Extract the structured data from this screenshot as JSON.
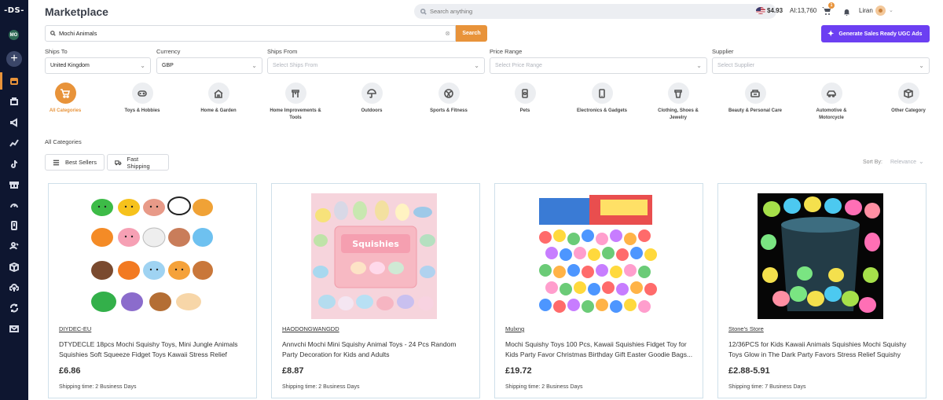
{
  "sidebar": {
    "logo": "-DS-",
    "avatar_initials": "MO",
    "items": [
      "add",
      "marketplace",
      "store",
      "campaigns",
      "analytics",
      "tiktok",
      "gift",
      "speed",
      "orders",
      "users",
      "packages",
      "upload",
      "sync",
      "mail"
    ]
  },
  "header": {
    "title": "Marketplace",
    "search_placeholder": "Search anything",
    "balance": "$4.93",
    "ai_credits": "AI:13,760",
    "cart_count": "1",
    "user_name": "Liran"
  },
  "search": {
    "value": "Mochi Animals",
    "button_label": "Search",
    "ugc_button_label": "Generate Sales Ready UGC Ads"
  },
  "filters": {
    "ships_to": {
      "label": "Ships To",
      "value": "United Kingdom"
    },
    "currency": {
      "label": "Currency",
      "value": "GBP"
    },
    "ships_from": {
      "label": "Ships From",
      "placeholder": "Select Ships From"
    },
    "price_range": {
      "label": "Price Range",
      "placeholder": "Select Price Range"
    },
    "supplier": {
      "label": "Supplier",
      "placeholder": "Select Supplier"
    }
  },
  "categories": [
    {
      "label": "All Categories",
      "icon": "cart-icon",
      "active": true
    },
    {
      "label": "Toys & Hobbies",
      "icon": "gamepad-icon"
    },
    {
      "label": "Home & Garden",
      "icon": "house-icon"
    },
    {
      "label": "Home Improvements & Tools",
      "icon": "tools-icon"
    },
    {
      "label": "Outdoors",
      "icon": "umbrella-icon"
    },
    {
      "label": "Sports & Fitness",
      "icon": "ball-icon"
    },
    {
      "label": "Pets",
      "icon": "pet-food-icon"
    },
    {
      "label": "Electronics & Gadgets",
      "icon": "phone-icon"
    },
    {
      "label": "Clothing, Shoes & Jewelry",
      "icon": "clothing-icon"
    },
    {
      "label": "Beauty & Personal Care",
      "icon": "beauty-icon"
    },
    {
      "label": "Automotive & Motorcycle",
      "icon": "car-icon"
    },
    {
      "label": "Other Category",
      "icon": "box-icon"
    }
  ],
  "listing": {
    "breadcrumb": "All Categories",
    "chips": {
      "best_sellers": "Best Sellers",
      "fast_shipping": "Fast Shipping"
    },
    "sort_label": "Sort By:",
    "sort_value": "Relevance"
  },
  "products": [
    {
      "supplier": "DIYDEC-EU",
      "title": "DTYDECLE 18pcs Mochi Squishy Toys, Mini Jungle Animals Squishies Soft Squeeze Fidget Toys Kawaii Stress Relief Toys...",
      "price": "£6.86",
      "shipping": "Shipping time: 2 Business Days",
      "image": "mochi-animals-grid"
    },
    {
      "supplier": "HAODONGWANGDD",
      "title": "Annvchi Mochi Mini Squishy Animal Toys - 24 Pcs Random Party Decoration for Kids and Adults",
      "price": "£8.87",
      "shipping": "Shipping time: 2 Business Days",
      "image": "squishies-box"
    },
    {
      "supplier": "Mulxng",
      "title": "Mochi Squishy Toys 100 Pcs, Kawaii Squishies Fidget Toy for Kids Party Favor Christmas Birthday Gift Easter Goodie Bags...",
      "price": "£19.72",
      "shipping": "Shipping time: 2 Business Days",
      "image": "squishies-pile"
    },
    {
      "supplier": "Stone's Store",
      "title": "12/36PCS for Kids Kawaii Animals Squishies Mochi Squishy Toys Glow in The Dark Party Favors Stress Relief Squishy",
      "price": "£2.88-5.91",
      "shipping": "Shipping time: 7 Business Days",
      "image": "glow-squishies-bucket"
    }
  ]
}
